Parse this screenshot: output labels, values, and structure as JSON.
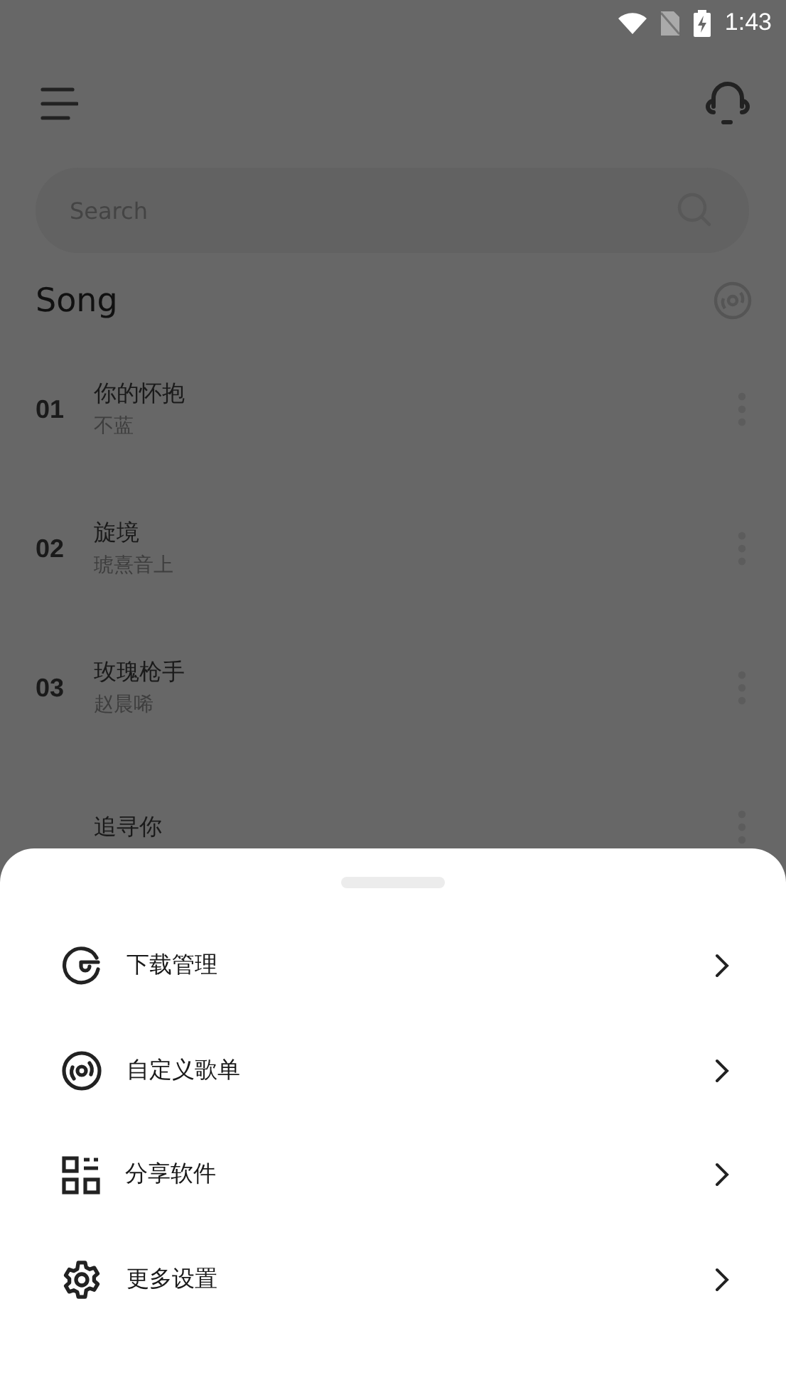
{
  "status_bar": {
    "time": "1:43"
  },
  "search": {
    "placeholder": "Search"
  },
  "section": {
    "title": "Song"
  },
  "songs": [
    {
      "number": "01",
      "title": "你的怀抱",
      "artist": "不蓝"
    },
    {
      "number": "02",
      "title": "旋境",
      "artist": "琥熹音上"
    },
    {
      "number": "03",
      "title": "玫瑰枪手",
      "artist": "赵晨唏"
    },
    {
      "title": "追寻你"
    }
  ],
  "sheet": {
    "items": [
      {
        "kind": "download",
        "label": "下载管理"
      },
      {
        "kind": "playlist",
        "label": "自定义歌单"
      },
      {
        "kind": "share",
        "label": "分享软件"
      },
      {
        "kind": "settings",
        "label": "更多设置"
      }
    ]
  }
}
